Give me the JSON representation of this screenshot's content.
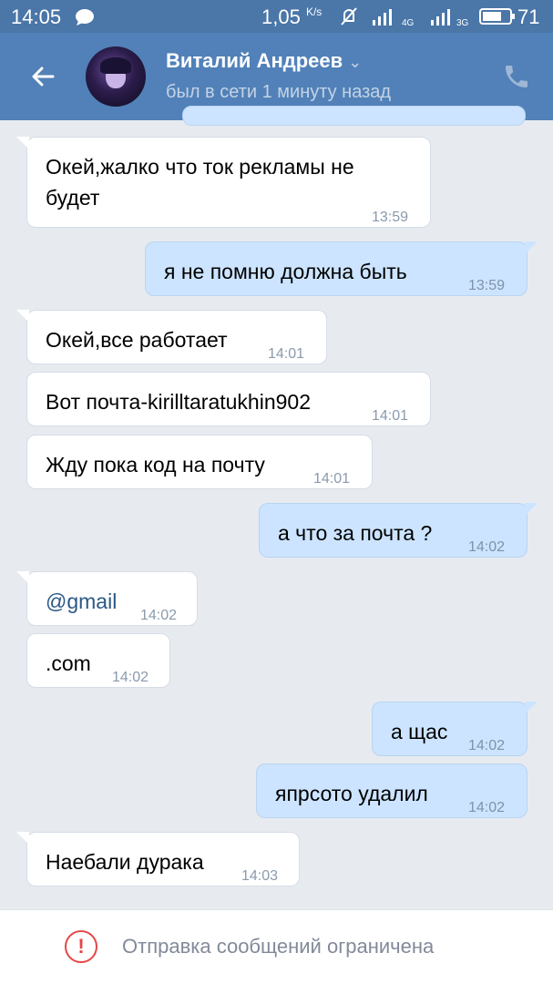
{
  "status_bar": {
    "time": "14:05",
    "speed": "1,05",
    "speed_unit": "K/s",
    "net1": "4G",
    "net2": "3G",
    "battery": "71",
    "battery_level": 0.71
  },
  "header": {
    "name": "Виталий Андреев",
    "status": "был в сети 1 минуту назад"
  },
  "messages": [
    {
      "side": "in",
      "text_line1": "Окей,жалко что ток рекламы не",
      "text_line2": "будет",
      "time": "13:59"
    },
    {
      "side": "out",
      "text": "я не помню должна быть",
      "time": "13:59"
    },
    {
      "side": "in",
      "text": "Окей,все работает",
      "time": "14:01"
    },
    {
      "side": "in",
      "text": "Вот почта-kirilltaratukhin902",
      "time": "14:01"
    },
    {
      "side": "in",
      "text": "Жду пока код на почту",
      "time": "14:01"
    },
    {
      "side": "out",
      "text": "а что за почта ?",
      "time": "14:02"
    },
    {
      "side": "in",
      "text": "@gmail",
      "time": "14:02"
    },
    {
      "side": "in",
      "text": ".com",
      "time": "14:02"
    },
    {
      "side": "out",
      "text": "а щас",
      "time": "14:02"
    },
    {
      "side": "out",
      "text": "япрсото удалил",
      "time": "14:02"
    },
    {
      "side": "in",
      "text": "Наебали дурака",
      "time": "14:03"
    }
  ],
  "footer": {
    "notice": "Отправка сообщений ограничена",
    "icon": "!"
  }
}
